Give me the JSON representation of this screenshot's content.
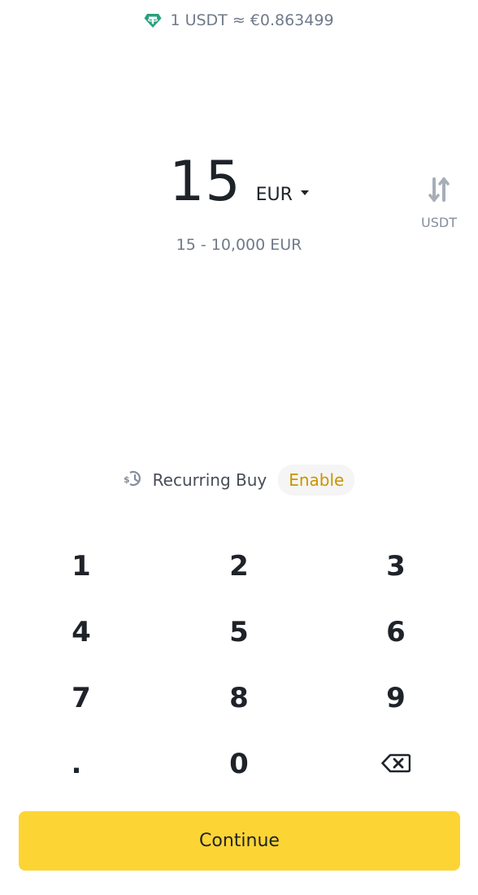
{
  "rate": {
    "icon": "tether-icon",
    "text": "1 USDT ≈ €0.863499"
  },
  "amount": {
    "value": "15",
    "currency": "EUR",
    "range": "15 - 10,000 EUR"
  },
  "switch": {
    "icon": "swap-arrows-icon",
    "label": "USDT"
  },
  "recurring": {
    "icon": "recurring-dollar-icon",
    "label": "Recurring Buy",
    "enable_label": "Enable"
  },
  "keypad": {
    "keys": [
      "1",
      "2",
      "3",
      "4",
      "5",
      "6",
      "7",
      "8",
      "9",
      ".",
      "0"
    ],
    "backspace_icon": "backspace-icon"
  },
  "continue_label": "Continue",
  "colors": {
    "accent": "#fcd535",
    "enable_text": "#c99400",
    "tether": "#26a17b",
    "text_primary": "#1e2329",
    "text_secondary": "#707a8a"
  }
}
